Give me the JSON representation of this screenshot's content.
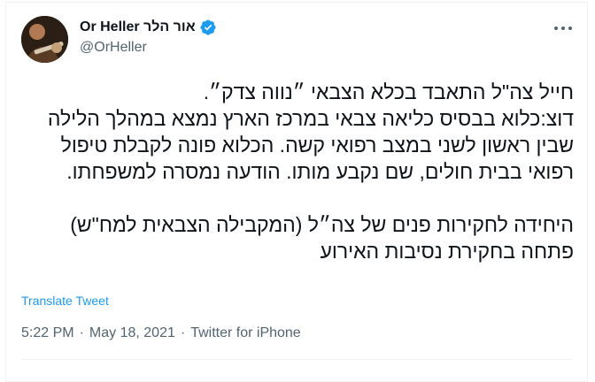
{
  "tweet": {
    "author": {
      "display_name": "Or Heller אור הלר",
      "handle": "@OrHeller",
      "verified": true,
      "avatar_icon": "profile-photo-guitarist"
    },
    "text": "חייל צה\"ל התאבד בכלא הצבאי ״נווה צדק״.\nדוצ:כלוא בבסיס כליאה צבאי במרכז הארץ נמצא במהלך הלילה שבין ראשון לשני במצב רפואי קשה. הכלוא פונה לקבלת טיפול רפואי בבית חולים, שם נקבע מותו. הודעה נמסרה למשפחתו.\n\nהיחידה לחקירות פנים של צה״ל (המקבילה הצבאית למח\"ש) פתחה בחקירת נסיבות האירוע",
    "translate_label": "Translate Tweet",
    "time": "5:22 PM",
    "date": "May 18, 2021",
    "source": "Twitter for iPhone",
    "separator": "·"
  },
  "colors": {
    "link": "#1d9bf0",
    "muted": "#536471",
    "text": "#0f1419",
    "verified": "#1d9bf0"
  }
}
